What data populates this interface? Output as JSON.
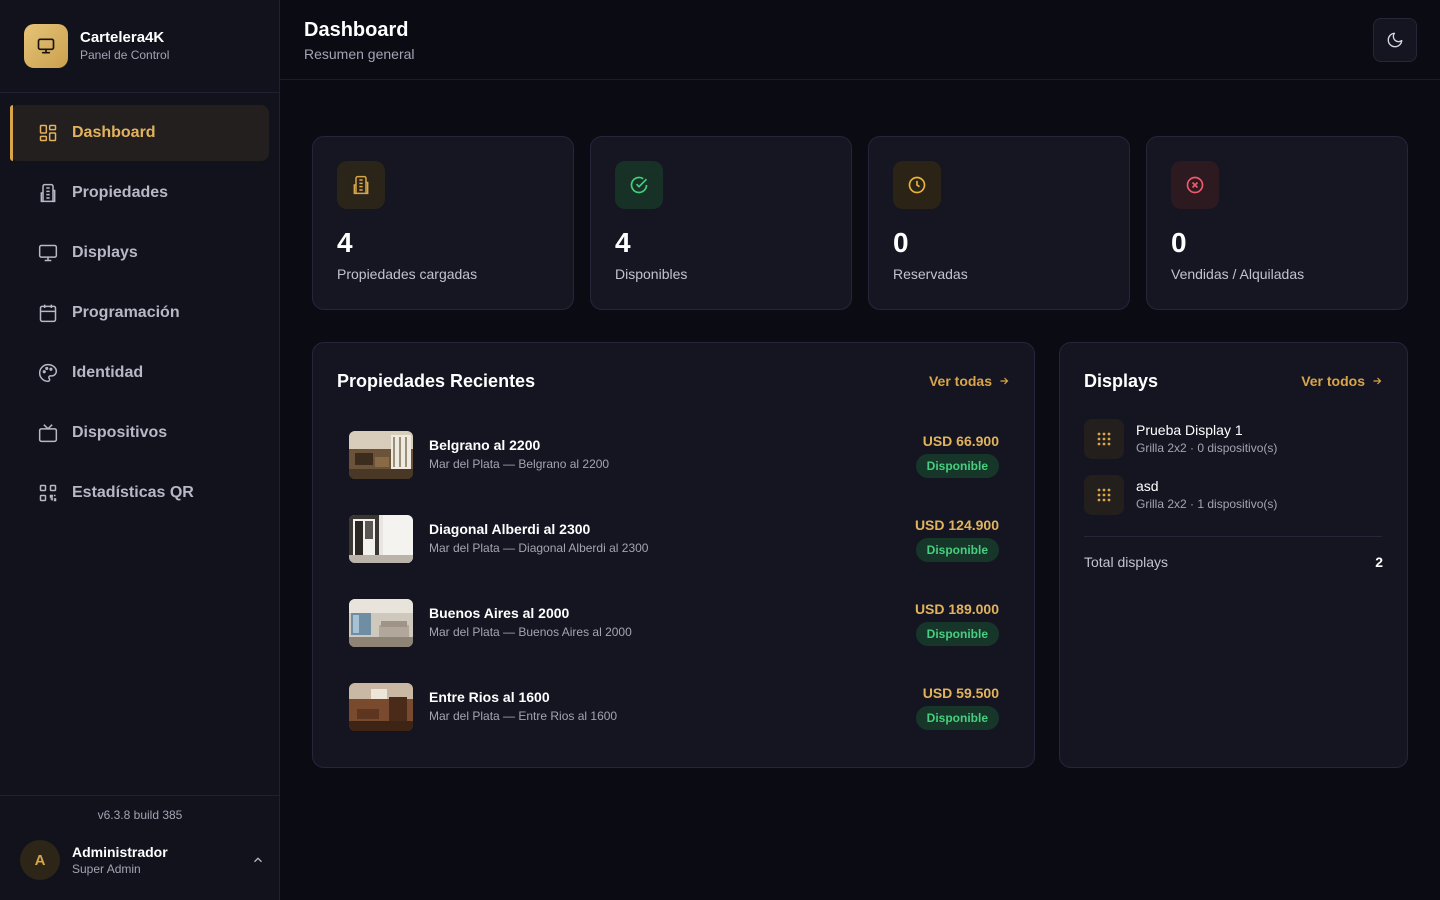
{
  "brand": {
    "title": "Cartelera4K",
    "subtitle": "Panel de Control",
    "icon": "monitor-icon"
  },
  "nav": [
    {
      "label": "Dashboard",
      "icon": "dashboard-icon",
      "active": true
    },
    {
      "label": "Propiedades",
      "icon": "building-icon"
    },
    {
      "label": "Displays",
      "icon": "monitor-icon"
    },
    {
      "label": "Programación",
      "icon": "calendar-icon"
    },
    {
      "label": "Identidad",
      "icon": "palette-icon"
    },
    {
      "label": "Dispositivos",
      "icon": "tv-icon"
    },
    {
      "label": "Estadísticas QR",
      "icon": "qr-code-icon"
    }
  ],
  "version": "v6.3.8 build 385",
  "user": {
    "initial": "A",
    "name": "Administrador",
    "role": "Super Admin"
  },
  "header": {
    "title": "Dashboard",
    "subtitle": "Resumen general",
    "theme_icon": "moon-icon"
  },
  "stats": [
    {
      "value": "4",
      "label": "Propiedades cargadas",
      "icon": "building-icon",
      "color": "#d9a548"
    },
    {
      "value": "4",
      "label": "Disponibles",
      "icon": "check-circle-icon",
      "color": "#45cf7e"
    },
    {
      "value": "0",
      "label": "Reservadas",
      "icon": "clock-icon",
      "color": "#e8b43a"
    },
    {
      "value": "0",
      "label": "Vendidas / Alquiladas",
      "icon": "x-circle-icon",
      "color": "#ef5a6b"
    }
  ],
  "recent": {
    "title": "Propiedades Recientes",
    "link": "Ver todas",
    "items": [
      {
        "name": "Belgrano al 2200",
        "address": "Mar del Plata — Belgrano al 2200",
        "price": "USD 66.900",
        "status": "Disponible"
      },
      {
        "name": "Diagonal Alberdi al 2300",
        "address": "Mar del Plata — Diagonal Alberdi al 2300",
        "price": "USD 124.900",
        "status": "Disponible"
      },
      {
        "name": "Buenos Aires al 2000",
        "address": "Mar del Plata — Buenos Aires al 2000",
        "price": "USD 189.000",
        "status": "Disponible"
      },
      {
        "name": "Entre Rios al 1600",
        "address": "Mar del Plata — Entre Rios al 1600",
        "price": "USD 59.500",
        "status": "Disponible"
      }
    ]
  },
  "displays": {
    "title": "Displays",
    "link": "Ver todos",
    "items": [
      {
        "name": "Prueba Display 1",
        "meta": "Grilla 2x2 · 0 dispositivo(s)",
        "icon": "grid-icon"
      },
      {
        "name": "asd",
        "meta": "Grilla 2x2 · 1 dispositivo(s)",
        "icon": "grid-icon"
      }
    ],
    "total_label": "Total displays",
    "total_value": "2"
  },
  "colors": {
    "accent": "#d9a548",
    "success": "#45cf7e",
    "background": "#0b0b13"
  }
}
